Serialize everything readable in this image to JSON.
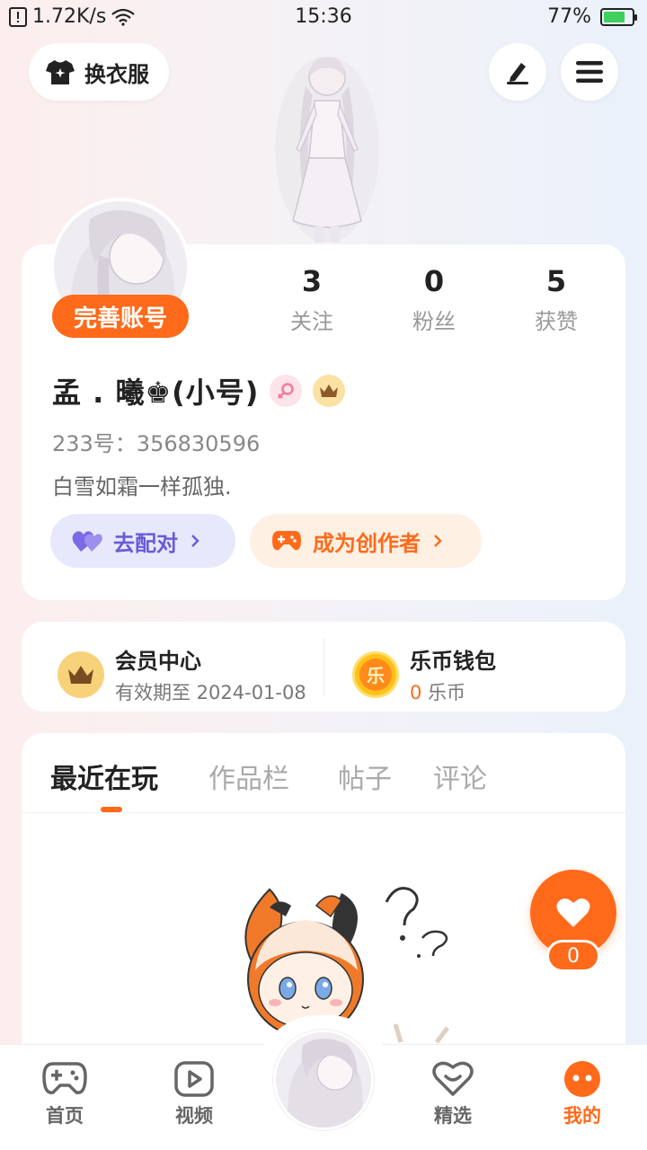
{
  "status_bar": {
    "speed": "1.72K/s",
    "time": "15:36",
    "battery": "77%",
    "battery_level": 0.77
  },
  "header": {
    "outfit_label": "换衣服",
    "edit_icon": "pen-icon",
    "menu_icon": "hamburger-menu-icon"
  },
  "profile": {
    "complete_account_label": "完善账号",
    "stats": [
      {
        "num": "3",
        "label": "关注"
      },
      {
        "num": "0",
        "label": "粉丝"
      },
      {
        "num": "5",
        "label": "获赞"
      }
    ],
    "username": "孟 . 曦♚(小号)",
    "uid": "233号：356830596",
    "bio": "白雪如霜一样孤独.",
    "match_label": "去配对",
    "creator_label": "成为创作者"
  },
  "member": {
    "vip_title": "会员中心",
    "vip_sub": "有效期至 2024-01-08",
    "wallet_title": "乐币钱包",
    "coin_amount": "0",
    "coin_unit": "乐币",
    "coin_badge": "乐"
  },
  "tabs": [
    {
      "label": "最近在玩",
      "active": true
    },
    {
      "label": "作品栏",
      "active": false
    },
    {
      "label": "帖子",
      "active": false
    },
    {
      "label": "评论",
      "active": false
    }
  ],
  "like": {
    "count": "0"
  },
  "nav": [
    {
      "label": "首页",
      "icon": "gamepad-icon"
    },
    {
      "label": "视频",
      "icon": "play-icon"
    },
    {
      "label": "精选",
      "icon": "heart-icon"
    },
    {
      "label": "我的",
      "icon": "smiley-icon"
    }
  ],
  "colors": {
    "accent": "#ff6a1a",
    "match": "#6a5ad8"
  }
}
